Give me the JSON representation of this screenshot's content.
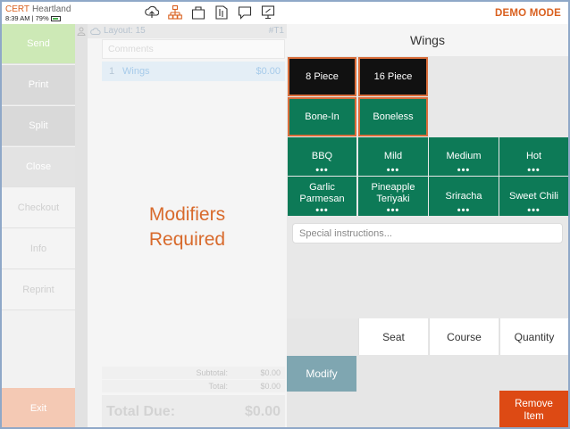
{
  "status_bar": {
    "cert": "CERT",
    "processor": "Heartland",
    "time_battery": "8:39 AM | 79%",
    "demo_mode": "DEMO MODE",
    "icons": [
      "cloud-upload-icon",
      "network-icon",
      "folder-icon",
      "book-icon",
      "chat-icon",
      "monitor-icon"
    ]
  },
  "left_actions": {
    "send": "Send",
    "print": "Print",
    "split": "Split",
    "close": "Close",
    "checkout": "Checkout",
    "info": "Info",
    "reprint": "Reprint",
    "exit": "Exit"
  },
  "order": {
    "layout": "Layout: 15",
    "ticket": "#T1",
    "comments_placeholder": "Comments",
    "line": {
      "qty": "1",
      "name": "Wings",
      "price": "$0.00"
    },
    "message_line1": "Modifiers",
    "message_line2": "Required",
    "subtotal_label": "Subtotal:",
    "subtotal_value": "$0.00",
    "total_label": "Total:",
    "total_value": "$0.00",
    "total_due_label": "Total Due:",
    "total_due_value": "$0.00"
  },
  "modifiers": {
    "title": "Wings",
    "piece_options": [
      {
        "label": "8 Piece",
        "selected": true
      },
      {
        "label": "16 Piece",
        "selected": true
      }
    ],
    "bone_options": [
      {
        "label": "Bone-In",
        "selected": true
      },
      {
        "label": "Boneless",
        "selected": true
      }
    ],
    "sauces": [
      {
        "line1": "BBQ",
        "line2": ""
      },
      {
        "line1": "Mild",
        "line2": ""
      },
      {
        "line1": "Medium",
        "line2": ""
      },
      {
        "line1": "Hot",
        "line2": ""
      },
      {
        "line1": "Garlic",
        "line2": "Parmesan"
      },
      {
        "line1": "Pineapple",
        "line2": "Teriyaki"
      },
      {
        "line1": "Sriracha",
        "line2": ""
      },
      {
        "line1": "Sweet Chili",
        "line2": ""
      }
    ],
    "more_indicator": "•••",
    "special_placeholder": "Special instructions...",
    "seat": "Seat",
    "course": "Course",
    "quantity": "Quantity",
    "modify": "Modify",
    "remove_line1": "Remove",
    "remove_line2": "Item"
  },
  "colors": {
    "accent_orange": "#d9601f",
    "modifier_green": "#0d7a57",
    "remove_red": "#dd4a14",
    "modify_blue": "#7fa6b1"
  }
}
